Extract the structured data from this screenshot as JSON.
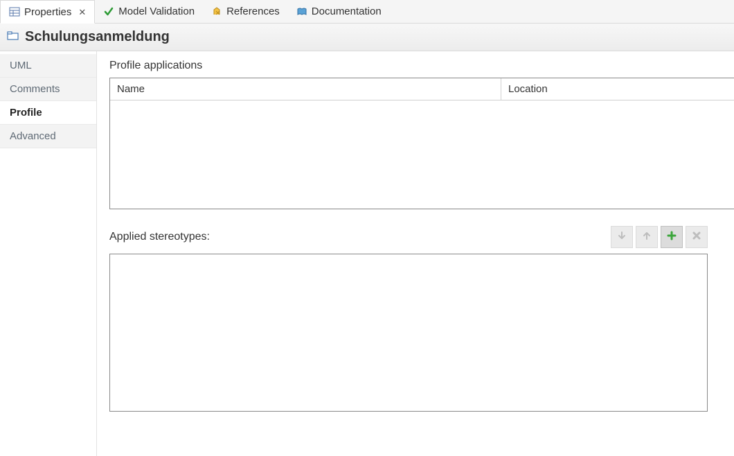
{
  "tabs": [
    {
      "label": "Properties",
      "active": true,
      "closable": true,
      "icon": "properties"
    },
    {
      "label": "Model Validation",
      "active": false,
      "closable": false,
      "icon": "check"
    },
    {
      "label": "References",
      "active": false,
      "closable": false,
      "icon": "references"
    },
    {
      "label": "Documentation",
      "active": false,
      "closable": false,
      "icon": "book"
    }
  ],
  "header": {
    "title": "Schulungsanmeldung"
  },
  "sidebar": {
    "items": [
      {
        "label": "UML",
        "active": false
      },
      {
        "label": "Comments",
        "active": false
      },
      {
        "label": "Profile",
        "active": true
      },
      {
        "label": "Advanced",
        "active": false
      }
    ]
  },
  "content": {
    "profile_applications_label": "Profile applications",
    "columns": {
      "name": "Name",
      "location": "Location"
    },
    "applied_stereotypes_label": "Applied stereotypes:"
  },
  "buttons": {
    "down": {
      "enabled": false
    },
    "up": {
      "enabled": false
    },
    "add": {
      "enabled": true
    },
    "remove": {
      "enabled": false
    }
  }
}
